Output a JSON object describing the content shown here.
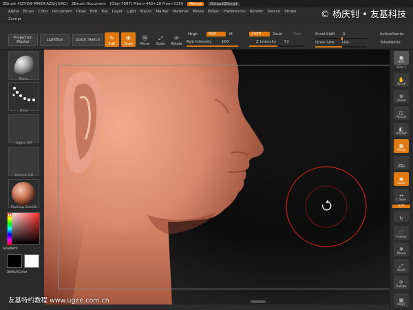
{
  "titlebar": {
    "app_title": "ZBrush 4[ZVDB-MMXR-AZSJ-JGAG]",
    "document": "ZBrush Document",
    "obj": "[Obj>7687] Mem>442+18 Free>2150",
    "menus_btn": "Menus",
    "default_script_btn": "DefaultZScript"
  },
  "watermark": {
    "top": "© 杨庆钊 • 友基科技",
    "bottom": "友基特约教程 www.ugee.com.cn"
  },
  "menubar": {
    "items": [
      "Alpha",
      "Brush",
      "Color",
      "Document",
      "Draw",
      "Edit",
      "File",
      "Layer",
      "Light",
      "Macro",
      "Marker",
      "Material",
      "Movie",
      "Picker",
      "Preferences",
      "Render",
      "Stencil",
      "Stroke"
    ],
    "zscript": "Zscript"
  },
  "toolbar": {
    "projection_master": "Projection Master",
    "lightbox": "LightBox",
    "quick_sketch": "Quick Sketch",
    "edit": "Edit",
    "draw": "Draw",
    "move": "Move",
    "scale": "Scale",
    "rotate": "Rotate",
    "mrgb": "Mrgb",
    "rgb": "Rgb",
    "m": "M",
    "rgb_intensity_label": "Rgb Intensity",
    "rgb_intensity_value": "100",
    "zadd": "Zadd",
    "zsub": "Zsub",
    "zcut": "Zcut",
    "z_intensity_label": "Z Intensity",
    "z_intensity_value": "51",
    "focal_shift_label": "Focal Shift",
    "focal_shift_value": "0",
    "draw_size_label": "Draw Size",
    "draw_size_value": "104",
    "active_points": "ActivePoints:",
    "total_points": "TotalPoints:"
  },
  "leftshelf": {
    "brush_label": "Move",
    "stroke_label": "Dots",
    "alpha_label": "Alpha Off",
    "texture_label": "Texture Off",
    "material_label": "MatCap Skin06",
    "gradient_label": "Gradient",
    "switch_color_label": "SwitchColor"
  },
  "rightshelf": {
    "bpr": "BPR",
    "spix_label": "SPix",
    "spix_value": "1",
    "scroll": "Scroll",
    "zoom": "Zoom",
    "actual": "Actual",
    "aahalf": "AAHalf",
    "persp": "Persp",
    "floor": "Floor",
    "local": "Local",
    "lsym": "L.Sym",
    "xyz": "XYZ",
    "frame": "Frame",
    "move": "Move",
    "scale": "Scale",
    "rotate": "Rotate",
    "polyf": "PolyF"
  },
  "colors": {
    "accent": "#e07a10",
    "cursor_ring": "#c0241c",
    "skin": "#d9876a"
  },
  "sliders": {
    "rgb_intensity": 1.0,
    "z_intensity": 0.51,
    "focal_shift": 0.5,
    "draw_size": 0.52
  }
}
